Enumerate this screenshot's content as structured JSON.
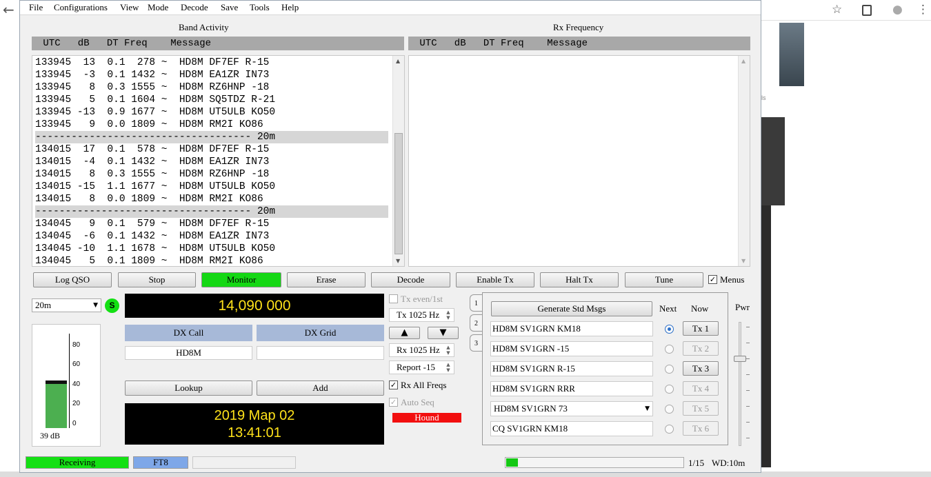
{
  "menu": [
    "File",
    "Configurations",
    "View",
    "Mode",
    "Decode",
    "Save",
    "Tools",
    "Help"
  ],
  "band_activity": {
    "title": "Band Activity",
    "header": " UTC   dB   DT Freq    Message",
    "lines": [
      "133945  13  0.1  278 ~  HD8M DF7EF R-15",
      "133945  -3  0.1 1432 ~  HD8M EA1ZR IN73",
      "133945   8  0.3 1555 ~  HD8M RZ6HNP -18",
      "133945   5  0.1 1604 ~  HD8M SQ5TDZ R-21",
      "133945 -13  0.9 1677 ~  HD8M UT5ULB KO50",
      "133945   9  0.0 1809 ~  HD8M RM2I KO86",
      "------------------------------------ 20m",
      "134015  17  0.1  578 ~  HD8M DF7EF R-15",
      "134015  -4  0.1 1432 ~  HD8M EA1ZR IN73",
      "134015   8  0.3 1555 ~  HD8M RZ6HNP -18",
      "134015 -15  1.1 1677 ~  HD8M UT5ULB KO50",
      "134015   8  0.0 1809 ~  HD8M RM2I KO86",
      "------------------------------------ 20m",
      "134045   9  0.1  579 ~  HD8M DF7EF R-15",
      "134045  -6  0.1 1432 ~  HD8M EA1ZR IN73",
      "134045 -10  1.1 1678 ~  HD8M UT5ULB KO50",
      "134045   5  0.1 1809 ~  HD8M RM2I KO86"
    ]
  },
  "rx_frequency": {
    "title": "Rx Frequency",
    "header": " UTC   dB   DT Freq    Message"
  },
  "buttons": {
    "log_qso": "Log QSO",
    "stop": "Stop",
    "monitor": "Monitor",
    "erase": "Erase",
    "decode": "Decode",
    "enable_tx": "Enable Tx",
    "halt_tx": "Halt Tx",
    "tune": "Tune",
    "menus": "Menus",
    "lookup": "Lookup",
    "add": "Add",
    "generate": "Generate Std Msgs"
  },
  "band": "20m",
  "s_badge": "S",
  "signal": {
    "level_db": 39,
    "label": "39 dB",
    "ticks": [
      "80",
      "60",
      "40",
      "20",
      "0"
    ]
  },
  "frequency_display": "14,090 000",
  "dx": {
    "call_label": "DX Call",
    "grid_label": "DX Grid",
    "call_value": "HD8M",
    "grid_value": ""
  },
  "clock": {
    "date": "2019 Map 02",
    "time": "13:41:01"
  },
  "controls": {
    "tx_even": "Tx even/1st",
    "tx_freq": "Tx  1025  Hz",
    "rx_freq": "Rx  1025  Hz",
    "report": "Report -15",
    "rx_all_freqs": "Rx All Freqs",
    "auto_seq": "Auto Seq",
    "hound": "Hound",
    "check": "✓",
    "up": "▲",
    "down": "▼"
  },
  "tabs": [
    "1",
    "2",
    "3"
  ],
  "tx_panel": {
    "next_label": "Next",
    "now_label": "Now",
    "messages": [
      "HD8M SV1GRN KM18",
      "HD8M SV1GRN -15",
      "HD8M SV1GRN R-15",
      "HD8M SV1GRN RRR",
      "HD8M SV1GRN 73",
      "CQ SV1GRN KM18"
    ],
    "tx_buttons": [
      "Tx 1",
      "Tx 2",
      "Tx 3",
      "Tx 4",
      "Tx 5",
      "Tx 6"
    ]
  },
  "pwr_label": "Pwr",
  "status": {
    "state": "Receiving",
    "mode": "FT8",
    "empty": "",
    "progress_fraction": 0.067,
    "sequence": "1/15",
    "watchdog": "WD:10m"
  },
  "colors": {
    "monitor_active": "#15d815",
    "receiving": "#14e014",
    "mode_bg": "#7ea7e8",
    "hound": "#f20f0f",
    "lcd_text": "#ffe21a",
    "dx_header": "#a7b9d8"
  },
  "browser": {
    "back_icon": "←",
    "star_icon": "☆",
    "profile_icon": "●",
    "more_icon": "⋮",
    "side_text": "ls"
  }
}
